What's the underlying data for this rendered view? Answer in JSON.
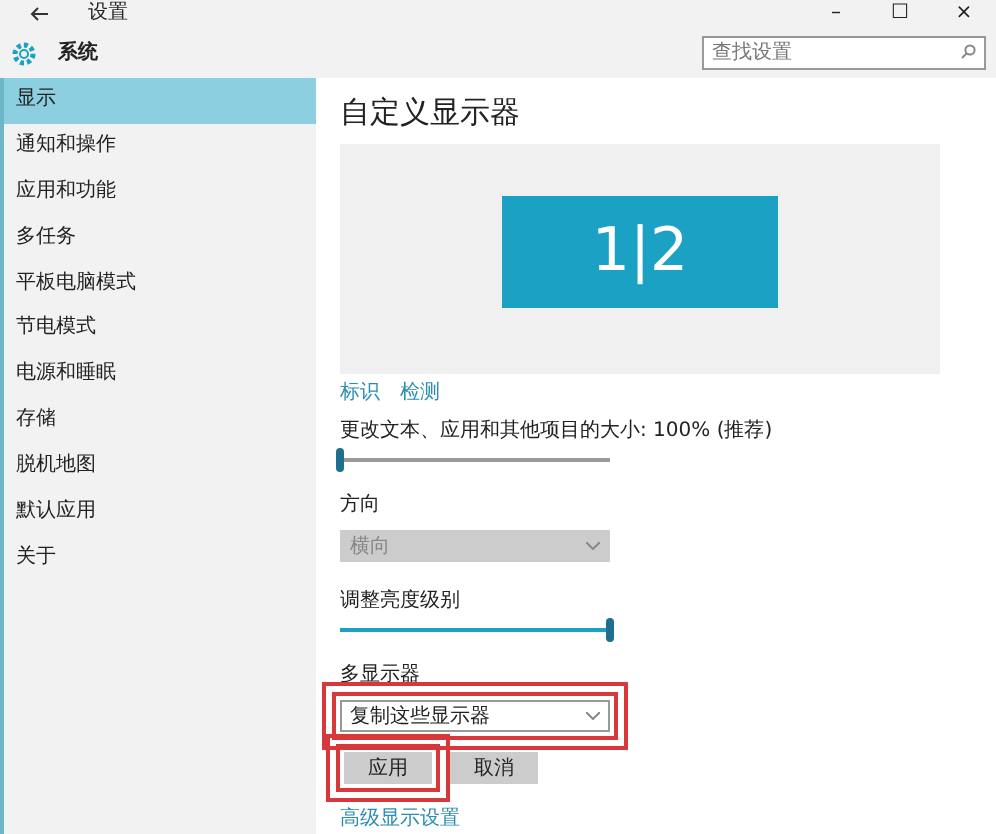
{
  "window": {
    "title": "设置",
    "controls": [
      "–",
      "☐",
      "×"
    ]
  },
  "header": {
    "title": "系统",
    "search": {
      "placeholder": "查找设置"
    }
  },
  "sidebar": {
    "items": [
      {
        "label": "显示",
        "selected": true
      },
      {
        "label": "通知和操作",
        "selected": false
      },
      {
        "label": "应用和功能",
        "selected": false
      },
      {
        "label": "多任务",
        "selected": false
      },
      {
        "label": "平板电脑模式",
        "selected": false
      },
      {
        "label": "节电模式",
        "selected": false
      },
      {
        "label": "电源和睡眠",
        "selected": false
      },
      {
        "label": "存储",
        "selected": false
      },
      {
        "label": "脱机地图",
        "selected": false
      },
      {
        "label": "默认应用",
        "selected": false
      },
      {
        "label": "关于",
        "selected": false
      }
    ]
  },
  "main": {
    "title": "自定义显示器",
    "monitor_label": "1|2",
    "links": [
      "标识",
      "检测"
    ],
    "scale": {
      "label": "更改文本、应用和其他项目的大小: 100% (推荐)",
      "level": 0
    },
    "orientation": {
      "label": "方向",
      "value": "横向",
      "disabled": true,
      "highlighted": false
    },
    "brightness": {
      "label": "调整亮度级别",
      "level": 1
    },
    "multi_display": {
      "label": "多显示器",
      "value": "复制这些显示器",
      "disabled": false,
      "highlighted": true
    },
    "buttons": [
      {
        "label": "应用",
        "highlighted": true
      },
      {
        "label": "取消",
        "highlighted": false
      }
    ],
    "advanced_link": "高级显示设置"
  }
}
